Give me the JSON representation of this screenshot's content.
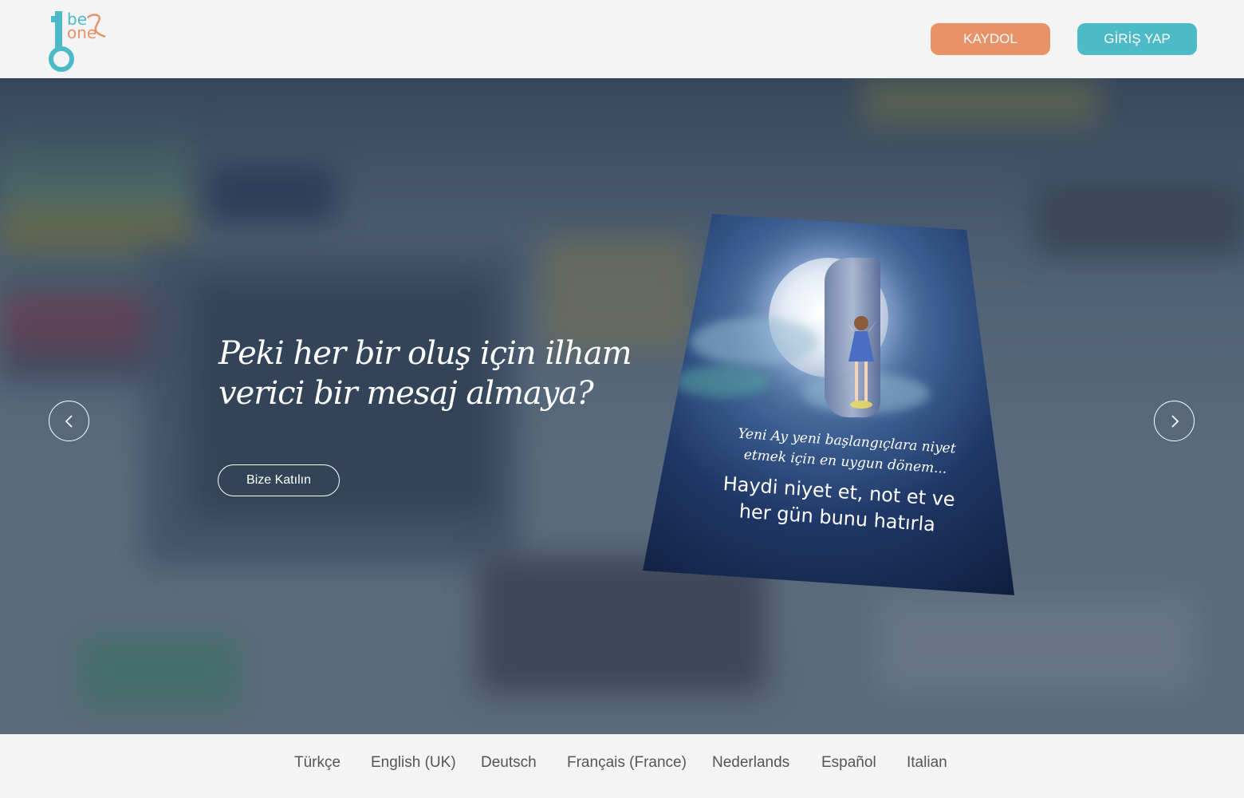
{
  "header": {
    "logo": {
      "word1": "be",
      "word2": "one",
      "ampersand": "&"
    },
    "signup_label": "KAYDOL",
    "login_label": "GİRİŞ YAP"
  },
  "hero": {
    "headline": "Peki her bir oluş için ilham verici bir mesaj almaya?",
    "cta_label": "Bize Katılın",
    "card": {
      "line1": "Yeni Ay yeni başlangıçlara niyet etmek için en uygun dönem...",
      "line2": "Haydi niyet et, not et ve her gün bunu hatırla"
    }
  },
  "footer": {
    "languages": [
      "Türkçe",
      "English (UK)",
      "Deutsch",
      "Français (France)",
      "Nederlands",
      "Español",
      "Italian"
    ]
  },
  "colors": {
    "signup": "#e8926a",
    "login": "#4cbac7",
    "background": "#f4f4f4"
  }
}
